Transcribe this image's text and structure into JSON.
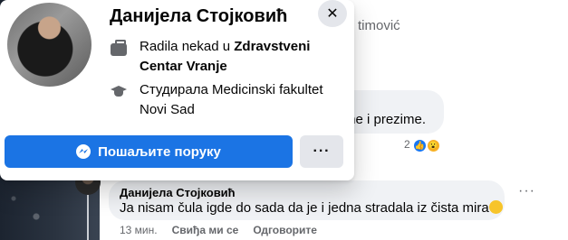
{
  "background": {
    "partial_name": "timović",
    "partial_comment": "me i prezime.",
    "reaction_count": "2"
  },
  "comment": {
    "author": "Данијела Стојковић",
    "text": "Ja nisam čula igde do sada da je i jedna stradala iz čista mira",
    "more": "···",
    "time": "13 мин.",
    "like_label": "Свиђа ми се",
    "reply_label": "Одговорите"
  },
  "hover_card": {
    "name": "Данијела Стојковић",
    "close": "✕",
    "work_prefix": "Radila nekad u ",
    "work_place": "Zdravstveni Centar Vranje",
    "education": "Студирала Medicinski fakultet Novi Sad",
    "message_button": "Пошаљите поруку",
    "more": "···"
  },
  "icons": {
    "close": "close-icon",
    "work": "briefcase-icon",
    "education": "graduation-cap-icon",
    "messenger": "messenger-icon",
    "more": "more-icon",
    "like_reaction": "like-reaction-icon",
    "wow_reaction": "wow-reaction-icon",
    "emoji": "thinking-emoji-icon"
  },
  "colors": {
    "accent": "#1b74e4",
    "bubble": "#f0f2f5",
    "secondary_text": "#65676b"
  }
}
